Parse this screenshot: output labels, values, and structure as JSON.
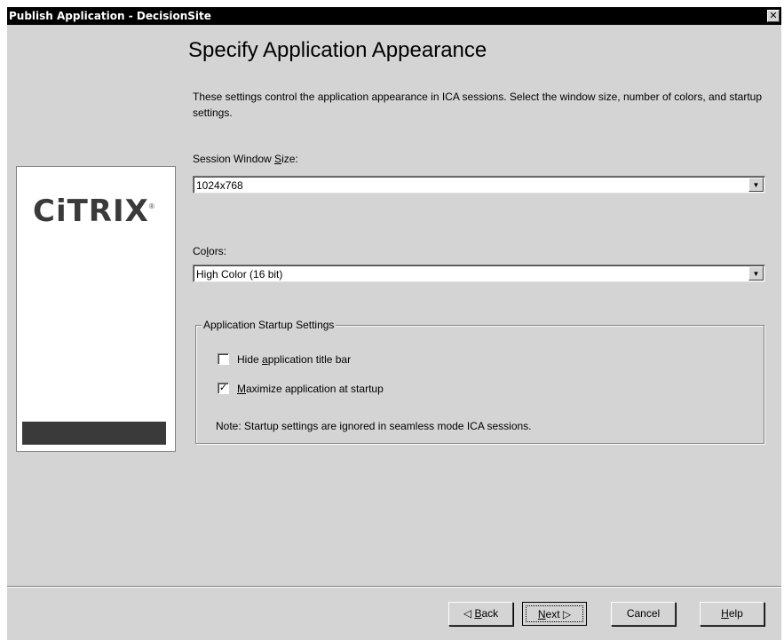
{
  "window": {
    "title": "Publish Application - DecisionSite",
    "close_label": "✕"
  },
  "heading": "Specify Application Appearance",
  "description": "These settings control the application appearance in ICA sessions.  Select the window size, number of colors, and startup settings.",
  "logo_text": "CiTRIX",
  "logo_reg": "®",
  "session_window_size": {
    "label_pre": "Session Window ",
    "label_acc": "S",
    "label_post": "ize:",
    "value": "1024x768"
  },
  "colors": {
    "label_pre": "Co",
    "label_acc": "l",
    "label_post": "ors:",
    "value": "High Color (16 bit)"
  },
  "startup": {
    "group_title": "Application Startup Settings",
    "hide_title_bar": {
      "label_pre": "Hide ",
      "label_acc": "a",
      "label_post": "pplication title bar",
      "checked": false
    },
    "maximize": {
      "label_pre": "",
      "label_acc": "M",
      "label_post": "aximize application at startup",
      "checked": true,
      "mark": "✓"
    },
    "note": "Note: Startup settings are ignored in seamless mode ICA sessions."
  },
  "buttons": {
    "back": {
      "arrow": "◁",
      "acc": "B",
      "rest": "ack"
    },
    "next": {
      "acc": "N",
      "rest": "ext",
      "arrow": "▷"
    },
    "cancel": "Cancel",
    "help": {
      "acc": "H",
      "rest": "elp"
    }
  },
  "dropdown_arrow": "▼"
}
